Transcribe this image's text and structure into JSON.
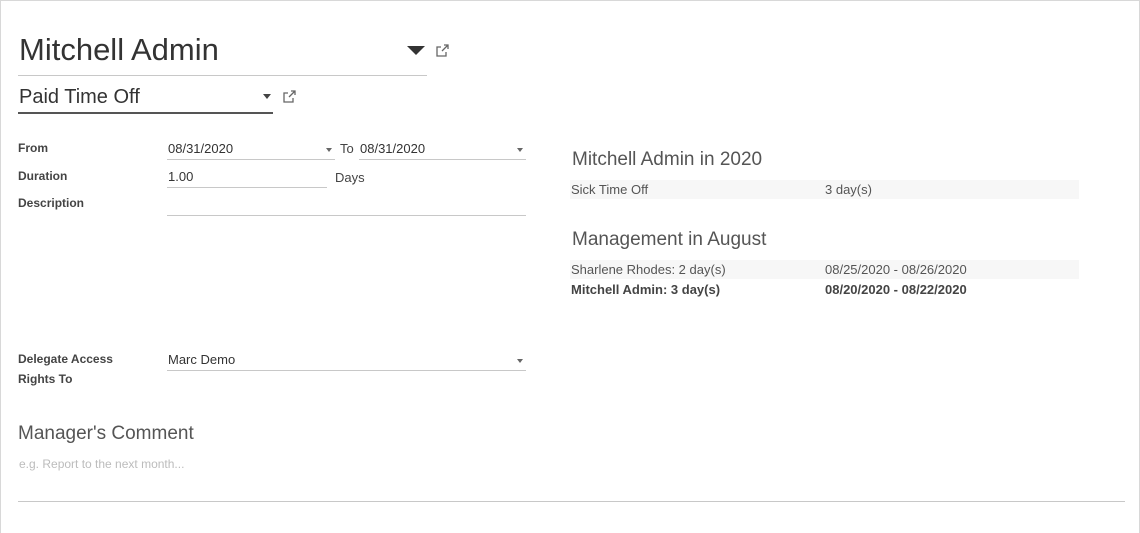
{
  "header": {
    "employee": "Mitchell Admin",
    "leave_type": "Paid Time Off"
  },
  "form": {
    "from_label": "From",
    "from_value": "08/31/2020",
    "to_label": "To",
    "to_value": "08/31/2020",
    "duration_label": "Duration",
    "duration_value": "1.00",
    "duration_unit": "Days",
    "description_label": "Description",
    "description_value": "",
    "delegate_label_line1": "Delegate Access",
    "delegate_label_line2": "Rights To",
    "delegate_value": "Marc Demo"
  },
  "summary": {
    "year_title": "Mitchell Admin in 2020",
    "year_rows": [
      {
        "name": "Sick Time Off",
        "value": "3 day(s)"
      }
    ],
    "dept_title": "Management in August",
    "dept_rows": [
      {
        "name": "Sharlene Rhodes: 2 day(s)",
        "value": "08/25/2020 - 08/26/2020"
      },
      {
        "name": "Mitchell Admin: 3 day(s)",
        "value": "08/20/2020 - 08/22/2020"
      }
    ]
  },
  "comment": {
    "title": "Manager's Comment",
    "placeholder": "e.g. Report to the next month..."
  }
}
